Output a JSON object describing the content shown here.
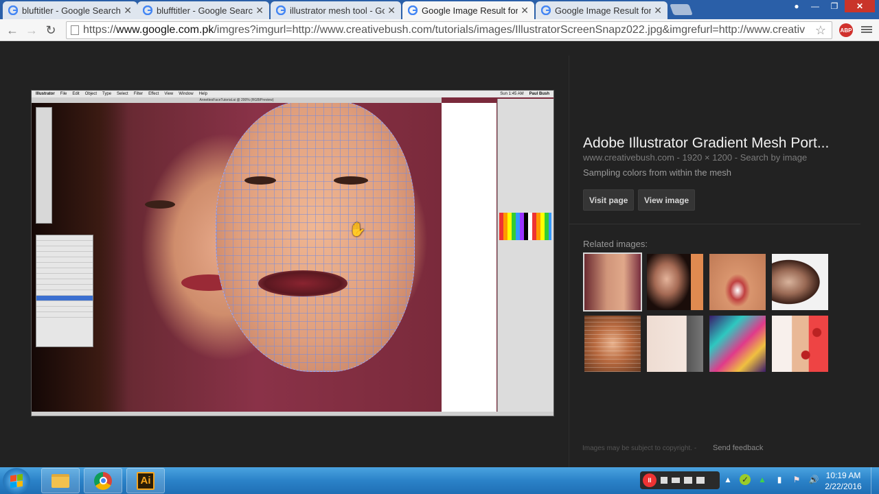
{
  "browser": {
    "tabs": [
      {
        "title": "bluftitler - Google Search"
      },
      {
        "title": "blufftitler - Google Search"
      },
      {
        "title": "illustrator mesh tool - Goo"
      },
      {
        "title": "Google Image Result for h"
      },
      {
        "title": "Google Image Result for h"
      }
    ],
    "active_tab_index": 3,
    "url_prefix": "https://",
    "url_host": "www.google.com.pk",
    "url_rest": "/imgres?imgurl=http://www.creativebush.com/tutorials/images/IllustratorScreenSnapz022.jpg&imgrefurl=http://www.creativ",
    "abp_label": "ABP"
  },
  "image_viewer": {
    "embedded_app": {
      "menubar": [
        "Illustrator",
        "File",
        "Edit",
        "Object",
        "Type",
        "Select",
        "Filter",
        "Effect",
        "View",
        "Window",
        "Help"
      ],
      "clock": "Sun 1:45 AM",
      "user": "Paul Bush",
      "document_title": "AnnettesFaceTutorial.ai @ 200% (RGB/Preview)"
    },
    "title": "Adobe Illustrator Gradient Mesh Port...",
    "meta": "www.creativebush.com - 1920 × 1200 - Search by image",
    "caption": "Sampling colors from within the mesh",
    "visit_page_label": "Visit page",
    "view_image_label": "View image",
    "related_label": "Related images:",
    "footer_note": "Images may be subject to copyright.",
    "footer_separator": "-",
    "send_feedback_label": "Send feedback"
  },
  "taskbar": {
    "clock_time": "10:19 AM",
    "clock_date": "2/22/2016",
    "illustrator_label": "Ai"
  },
  "colors": {
    "tabstrip": "#2a5fa8",
    "viewer_bg": "#222222",
    "accent_chrome_red": "#db4437"
  }
}
